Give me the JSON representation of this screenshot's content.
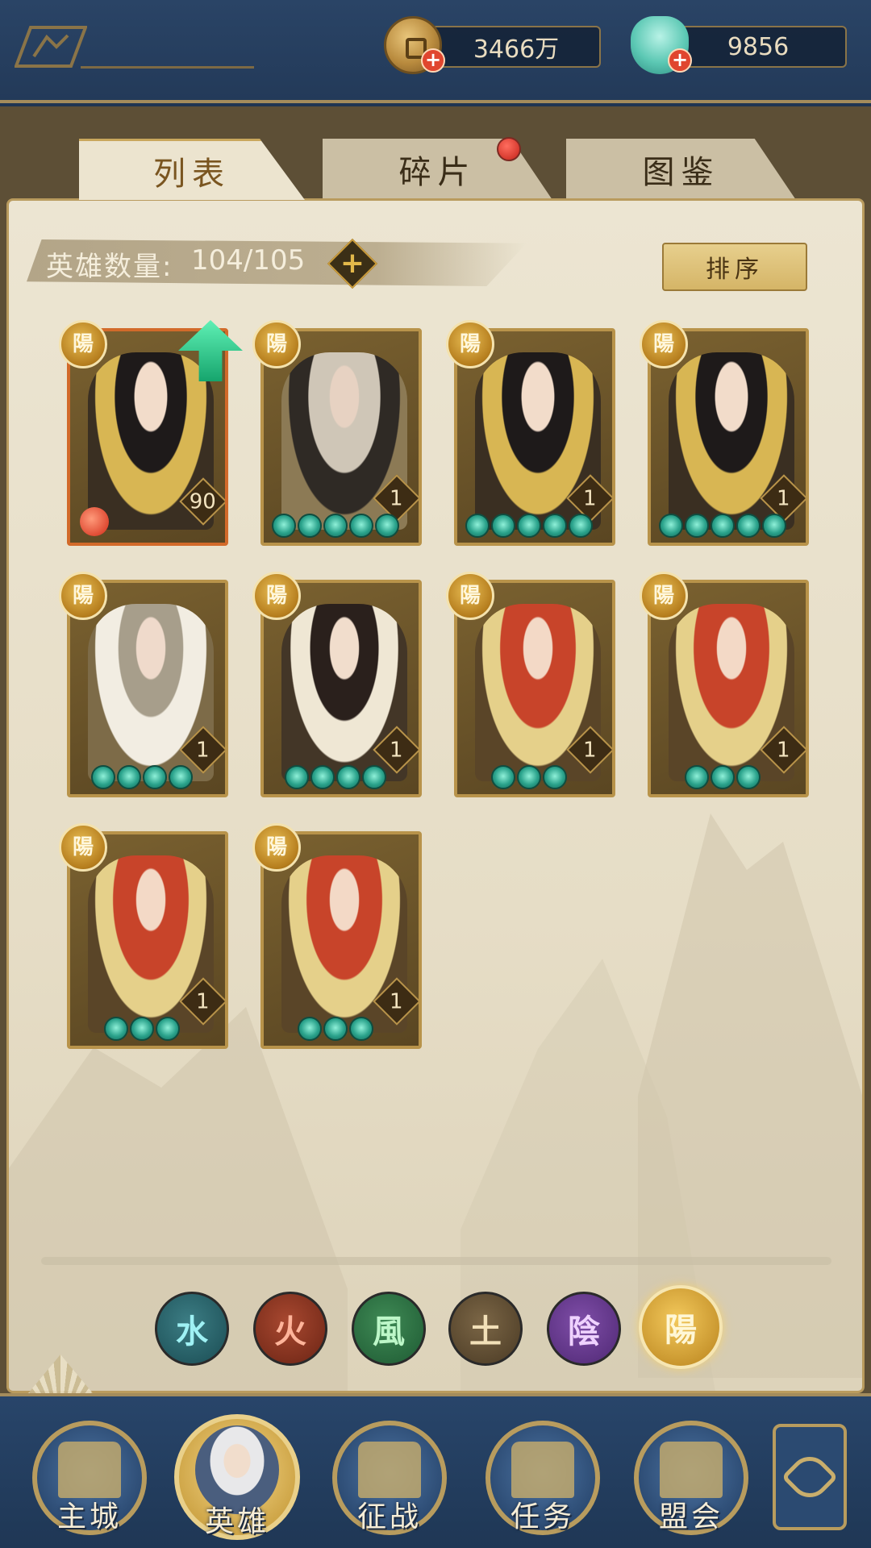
{
  "currencies": {
    "coins": "3466万",
    "shells": "9856",
    "coin_icon": "copper-coin-icon",
    "shell_icon": "jade-shell-icon",
    "add_symbol": "+"
  },
  "tabs": [
    {
      "label": "列表",
      "active": true
    },
    {
      "label": "碎片",
      "active": false,
      "notification": true
    },
    {
      "label": "图鉴",
      "active": false
    }
  ],
  "hero_count": {
    "label": "英雄数量:",
    "value": "104/105",
    "add_symbol": "+"
  },
  "sort_label": "排序",
  "heroes": [
    {
      "element": "陽",
      "level": "90",
      "stars": 0,
      "art": "black-hair-maiden",
      "upgrade_available": true
    },
    {
      "element": "陽",
      "level": "1",
      "stars": 5,
      "art": "silver-hair-warrior"
    },
    {
      "element": "陽",
      "level": "1",
      "stars": 5,
      "art": "black-hair-maiden"
    },
    {
      "element": "陽",
      "level": "1",
      "stars": 5,
      "art": "black-hair-maiden"
    },
    {
      "element": "陽",
      "level": "1",
      "stars": 4,
      "art": "grey-hair-scholar"
    },
    {
      "element": "陽",
      "level": "1",
      "stars": 4,
      "art": "long-dark-hair-lady"
    },
    {
      "element": "陽",
      "level": "1",
      "stars": 3,
      "art": "red-hair-fighter"
    },
    {
      "element": "陽",
      "level": "1",
      "stars": 3,
      "art": "red-hair-fighter"
    },
    {
      "element": "陽",
      "level": "1",
      "stars": 3,
      "art": "red-hair-fighter"
    },
    {
      "element": "陽",
      "level": "1",
      "stars": 3,
      "art": "red-hair-fighter"
    }
  ],
  "element_filters": [
    {
      "glyph": "水",
      "name": "water"
    },
    {
      "glyph": "火",
      "name": "fire"
    },
    {
      "glyph": "風",
      "name": "wind"
    },
    {
      "glyph": "土",
      "name": "earth"
    },
    {
      "glyph": "陰",
      "name": "yin"
    },
    {
      "glyph": "陽",
      "name": "yang",
      "selected": true
    }
  ],
  "nav": [
    {
      "label": "主城"
    },
    {
      "label": "英雄",
      "active": true
    },
    {
      "label": "征战"
    },
    {
      "label": "任务"
    },
    {
      "label": "盟会"
    }
  ],
  "colors": {
    "frame_blue": "#233a59",
    "gold_trim": "#b8934a",
    "parchment": "#ece5d2",
    "star_teal": "#2aa28b",
    "notify_red": "#c4231a"
  }
}
